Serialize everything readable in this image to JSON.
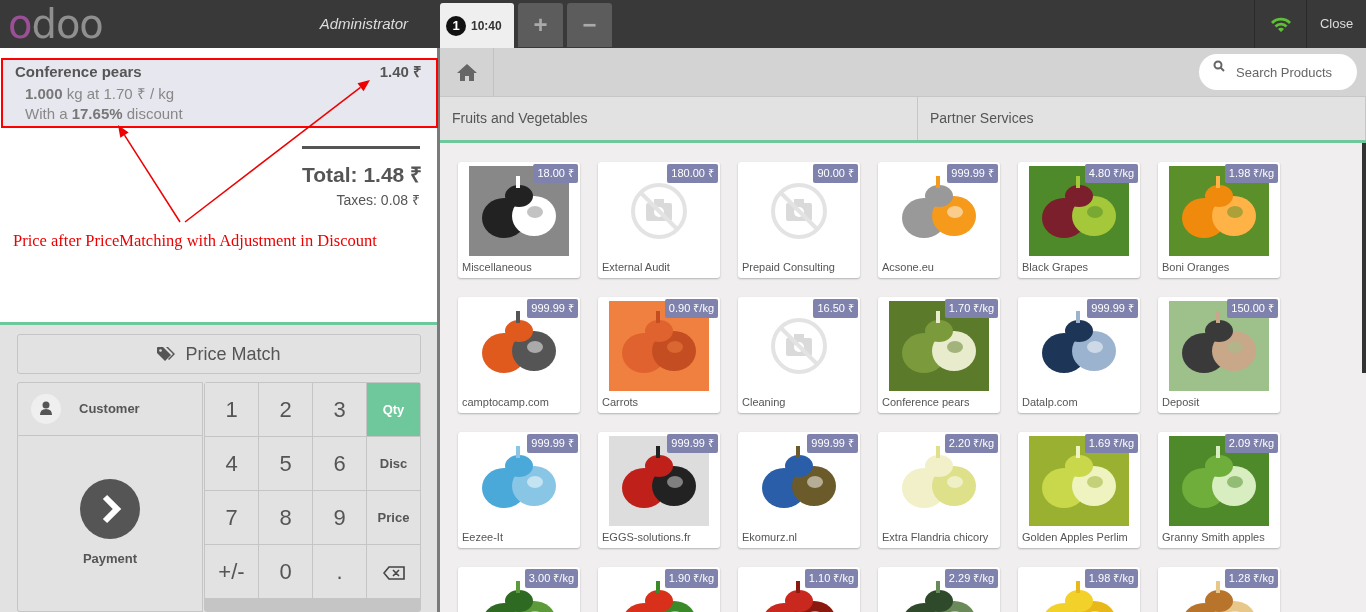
{
  "topbar": {
    "logo": "odoo",
    "user": "Administrator",
    "orders": [
      {
        "number": "1",
        "time": "10:40",
        "selected": true
      }
    ],
    "add_button": "+",
    "remove_button": "−",
    "close_button": "Close"
  },
  "order": {
    "lines": [
      {
        "product": "Conference pears",
        "price": "1.40 ₹",
        "quantity_text": "**1.000** kg at 1.70 ₹ / kg",
        "discount_text": "With a **17.65%** discount",
        "selected": true
      }
    ],
    "total": "Total: 1.48 ₹",
    "taxes": "Taxes: 0.08 ₹"
  },
  "annotation": "Price after PriceMatching with Adjustment in Discount",
  "actions": {
    "price_match": "Price Match",
    "customer": "Customer",
    "payment": "Payment"
  },
  "keypad": [
    {
      "label": "1",
      "kind": "digit",
      "selected": false
    },
    {
      "label": "2",
      "kind": "digit",
      "selected": false
    },
    {
      "label": "3",
      "kind": "digit",
      "selected": false
    },
    {
      "label": "Qty",
      "kind": "mode",
      "selected": true
    },
    {
      "label": "4",
      "kind": "digit",
      "selected": false
    },
    {
      "label": "5",
      "kind": "digit",
      "selected": false
    },
    {
      "label": "6",
      "kind": "digit",
      "selected": false
    },
    {
      "label": "Disc",
      "kind": "mode",
      "selected": false
    },
    {
      "label": "7",
      "kind": "digit",
      "selected": false
    },
    {
      "label": "8",
      "kind": "digit",
      "selected": false
    },
    {
      "label": "9",
      "kind": "digit",
      "selected": false
    },
    {
      "label": "Price",
      "kind": "mode",
      "selected": false
    },
    {
      "label": "+/-",
      "kind": "digit",
      "selected": false
    },
    {
      "label": "0",
      "kind": "digit",
      "selected": false
    },
    {
      "label": ".",
      "kind": "digit",
      "selected": false
    },
    {
      "kind": "backspace",
      "selected": false
    }
  ],
  "search": {
    "placeholder": "Search Products"
  },
  "categories": [
    "Fruits and Vegetables",
    "Partner Services"
  ],
  "products": [
    {
      "name": "Miscellaneous",
      "price": "18.00 ₹",
      "kind": "picture"
    },
    {
      "name": "External Audit",
      "price": "180.00 ₹",
      "kind": "no-image"
    },
    {
      "name": "Prepaid Consulting",
      "price": "90.00 ₹",
      "kind": "no-image"
    },
    {
      "name": "Acsone.eu",
      "price": "999.99 ₹",
      "kind": "picture"
    },
    {
      "name": "Black Grapes",
      "price": "4.80 ₹/kg",
      "kind": "picture"
    },
    {
      "name": "Boni Oranges",
      "price": "1.98 ₹/kg",
      "kind": "picture"
    },
    {
      "name": "camptocamp.com",
      "price": "999.99 ₹",
      "kind": "picture"
    },
    {
      "name": "Carrots",
      "price": "0.90 ₹/kg",
      "kind": "picture"
    },
    {
      "name": "Cleaning",
      "price": "16.50 ₹",
      "kind": "no-image"
    },
    {
      "name": "Conference pears",
      "price": "1.70 ₹/kg",
      "kind": "picture"
    },
    {
      "name": "Datalp.com",
      "price": "999.99 ₹",
      "kind": "picture"
    },
    {
      "name": "Deposit",
      "price": "150.00 ₹",
      "kind": "picture"
    },
    {
      "name": "Eezee-It",
      "price": "999.99 ₹",
      "kind": "picture"
    },
    {
      "name": "EGGS-solutions.fr",
      "price": "999.99 ₹",
      "kind": "picture"
    },
    {
      "name": "Ekomurz.nl",
      "price": "999.99 ₹",
      "kind": "picture"
    },
    {
      "name": "Extra Flandria chicory",
      "price": "2.20 ₹/kg",
      "kind": "picture"
    },
    {
      "name": "Golden Apples Perlim",
      "price": "1.69 ₹/kg",
      "kind": "picture"
    },
    {
      "name": "Granny Smith apples",
      "price": "2.09 ₹/kg",
      "kind": "picture"
    },
    {
      "price": "3.00 ₹/kg",
      "kind": "picture"
    },
    {
      "price": "1.90 ₹/kg",
      "kind": "picture"
    },
    {
      "price": "1.10 ₹/kg",
      "kind": "picture"
    },
    {
      "price": "2.29 ₹/kg",
      "kind": "picture"
    },
    {
      "price": "1.98 ₹/kg",
      "kind": "picture"
    },
    {
      "price": "1.28 ₹/kg",
      "kind": "picture"
    }
  ]
}
